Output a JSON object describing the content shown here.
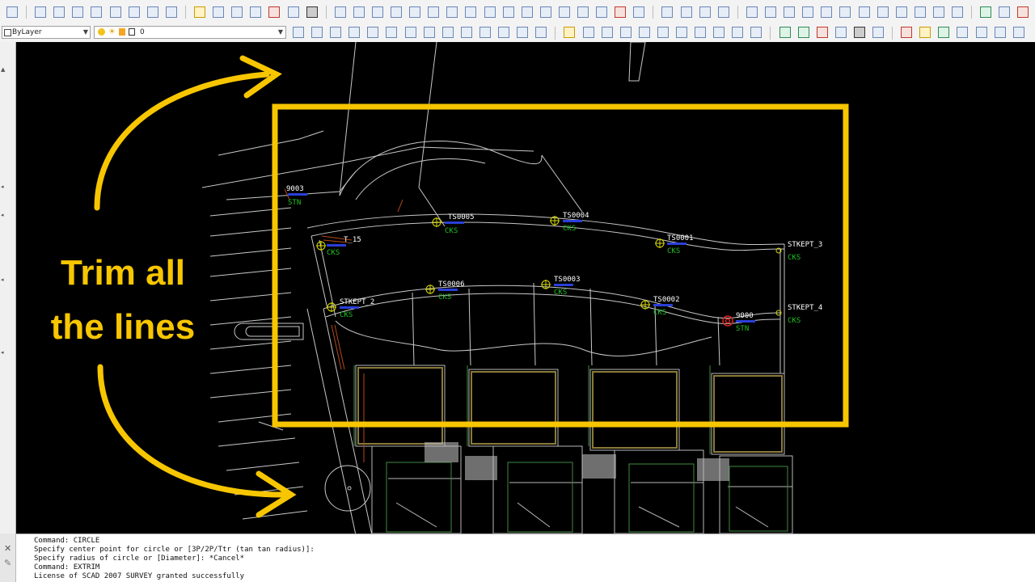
{
  "toolbar": {
    "layer_select_value": "ByLayer",
    "layer_combo_value": "0"
  },
  "drawing": {
    "points": [
      {
        "id": "9003",
        "code": "STN"
      },
      {
        "id": "TS0005",
        "code": "CKS"
      },
      {
        "id": "TS0004",
        "code": "CKS"
      },
      {
        "id": "T_15",
        "code": "CKS"
      },
      {
        "id": "TS0001",
        "code": "CKS"
      },
      {
        "id": "STKEPT_3",
        "code": "CKS"
      },
      {
        "id": "TS0006",
        "code": "CKS"
      },
      {
        "id": "TS0003",
        "code": "CKS"
      },
      {
        "id": "STKEPT_2",
        "code": "CKS"
      },
      {
        "id": "TS0002",
        "code": "CKS"
      },
      {
        "id": "9000",
        "code": "STN"
      },
      {
        "id": "STKEPT_4",
        "code": "CKS"
      }
    ]
  },
  "overlay": {
    "line1": "Trim all",
    "line2": "the lines",
    "accent_color": "#f7c600"
  },
  "command_line": {
    "lines": [
      "Command: CIRCLE",
      "Specify center point for circle or [3P/2P/Ttr (tan tan radius)]:",
      "Specify radius of circle or [Diameter]: *Cancel*",
      "Command: EXTRIM",
      "License of SCAD 2007 SURVEY granted successfully"
    ]
  },
  "icons": [
    "close-icon",
    "wrench-icon",
    "lightbulb-icon",
    "sun-icon",
    "lock-icon"
  ]
}
